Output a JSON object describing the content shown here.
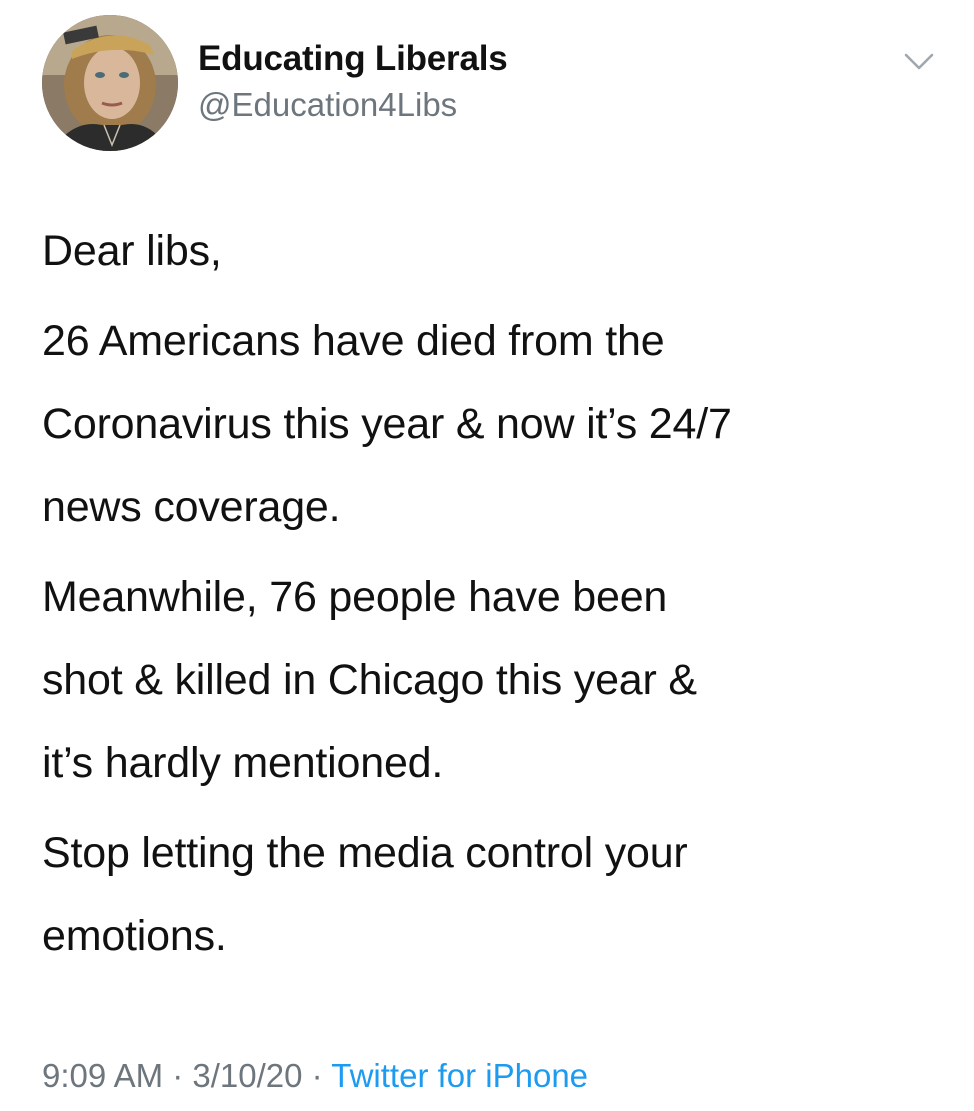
{
  "author": {
    "display_name": "Educating Liberals",
    "handle": "@Education4Libs"
  },
  "icons": {
    "menu": "chevron-down-icon",
    "avatar": "profile-photo"
  },
  "tweet": {
    "paragraphs": [
      "Dear libs,",
      "26 Americans have died from the\nCoronavirus this year & now it’s 24/7\nnews coverage.",
      "Meanwhile, 76 people have been\nshot & killed in Chicago this year &\nit’s hardly mentioned.",
      "Stop letting the media control your\nemotions."
    ]
  },
  "meta": {
    "time": "9:09 AM",
    "separator": " · ",
    "date": "3/10/20",
    "source": "Twitter for iPhone"
  },
  "colors": {
    "text": "#111111",
    "secondary": "#6e767d",
    "link": "#1d9bf0",
    "background": "#ffffff"
  }
}
